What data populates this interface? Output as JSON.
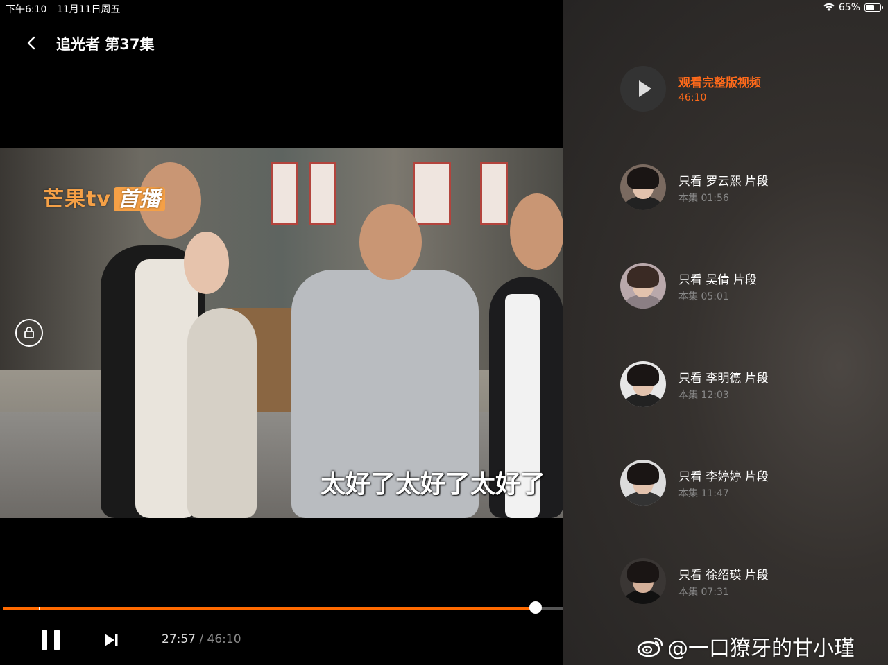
{
  "status_bar": {
    "time": "下午6:10",
    "date": "11月11日周五",
    "battery": "65%",
    "battery_level": 0.65
  },
  "player": {
    "title": "追光者 第37集",
    "logo_text": "芒果tv",
    "logo_badge": "首播",
    "subtitle": "太好了太好了太好了",
    "current_time": "27:57",
    "separator": "/",
    "duration": "46:10",
    "progress": 0.951
  },
  "side_panel": {
    "full_video": {
      "label": "观看完整版视频",
      "duration": "46:10"
    },
    "clips": [
      {
        "label": "只看 罗云熙 片段",
        "time": "本集 01:56"
      },
      {
        "label": "只看 吴倩 片段",
        "time": "本集 05:01"
      },
      {
        "label": "只看 李明德 片段",
        "time": "本集 12:03"
      },
      {
        "label": "只看 李婷婷 片段",
        "time": "本集 11:47"
      },
      {
        "label": "只看 徐绍瑛 片段",
        "time": "本集 07:31"
      }
    ]
  },
  "watermark": {
    "text": "@一口獠牙的甘小瑾"
  },
  "colors": {
    "accent": "#ff6a00",
    "panel_bg": "#2c2a28"
  }
}
